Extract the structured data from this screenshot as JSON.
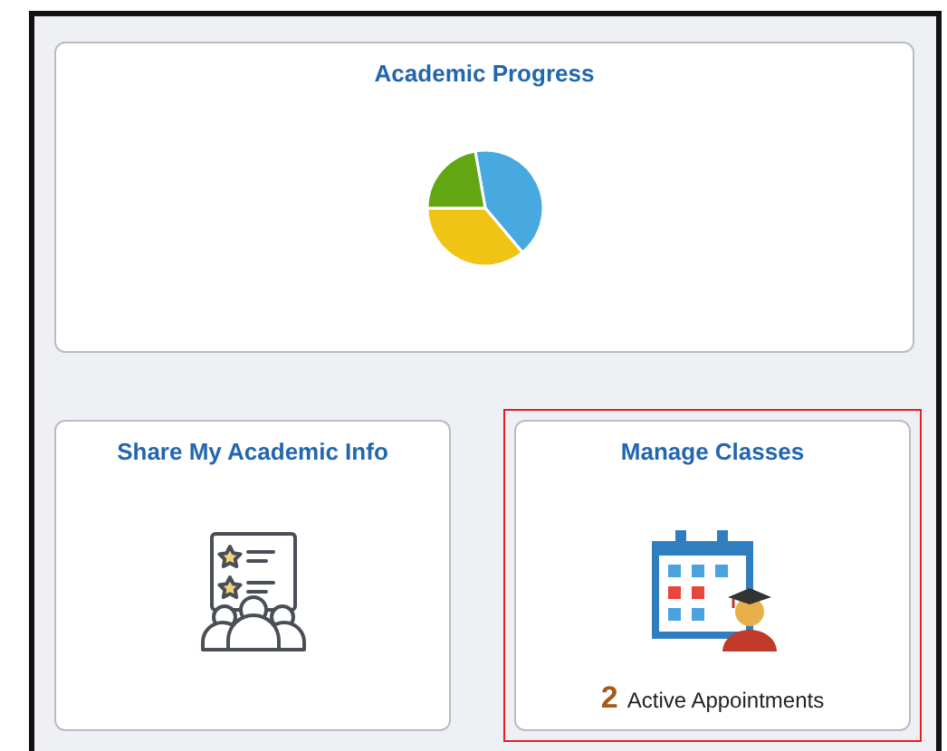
{
  "tiles": [
    {
      "title": "Academic Progress",
      "kind": "pie",
      "selected": false
    },
    {
      "title": "Share My Academic Info",
      "kind": "share",
      "selected": false
    },
    {
      "title": "Manage Classes",
      "kind": "classes",
      "selected": true,
      "count": "2",
      "count_label": "Active Appointments"
    }
  ]
}
